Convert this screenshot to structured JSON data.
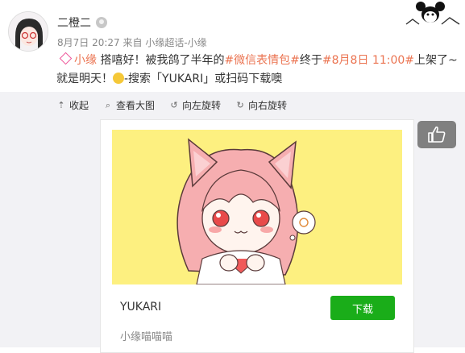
{
  "user": {
    "name": "二橙二",
    "date": "8月7日 20:27",
    "from_prefix": "来自",
    "source": "小缘超话-小缘"
  },
  "post": {
    "topic": "小缘",
    "text1": " 搭嘻好！被我鸽了半年的",
    "hashtag1": "#微信表情包#",
    "text2": "终于",
    "hashtag2": "#8月8日 11:00#",
    "text3": "上架了~就是明天！",
    "text4": "-搜索「YUKARI」或扫码下载噢"
  },
  "actions": [
    {
      "icon": "collapse-icon",
      "label": "收起"
    },
    {
      "icon": "zoom-icon",
      "label": "查看大图"
    },
    {
      "icon": "rotate-left-icon",
      "label": "向左旋转"
    },
    {
      "icon": "rotate-right-icon",
      "label": "向右旋转"
    }
  ],
  "card": {
    "title": "YUKARI",
    "download_label": "下载",
    "subtitle": "小缘喵喵喵"
  },
  "colors": {
    "link": "#eb7350",
    "download": "#1aad19",
    "banner": "#fdf080",
    "like_bg": "#808080"
  }
}
